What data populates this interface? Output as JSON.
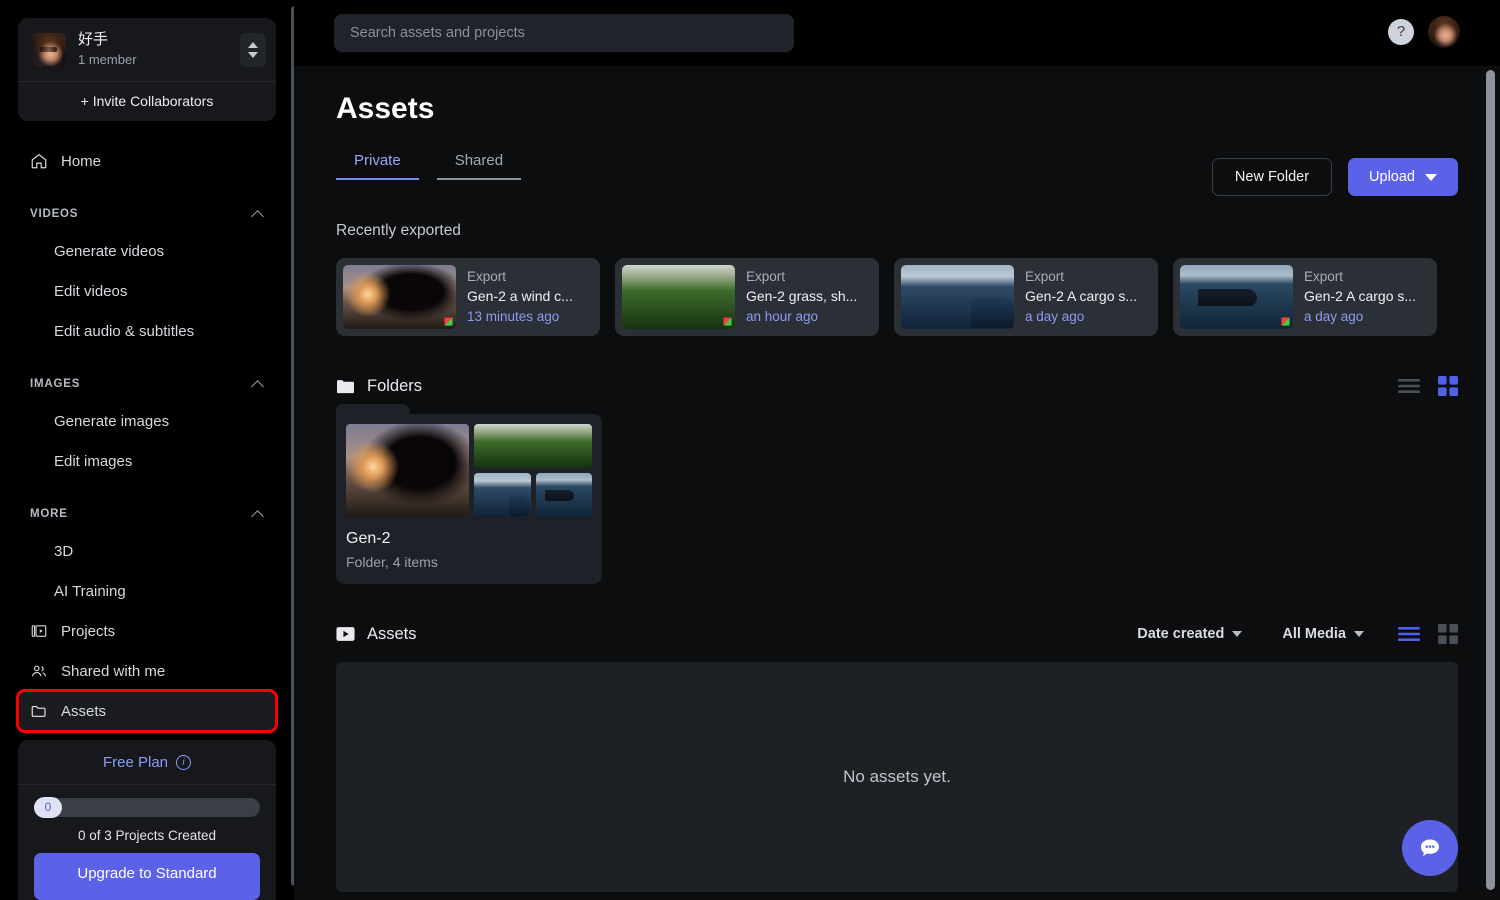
{
  "sidebar": {
    "team": {
      "name": "好手",
      "members": "1 member",
      "avatar": "user-avatar",
      "stepper_icon": "up-down-arrows-icon"
    },
    "invite_label": "+ Invite Collaborators",
    "home": {
      "label": "Home",
      "icon": "home-icon"
    },
    "sections": [
      {
        "label": "VIDEOS",
        "items": [
          {
            "label": "Generate videos"
          },
          {
            "label": "Edit videos"
          },
          {
            "label": "Edit audio & subtitles"
          }
        ]
      },
      {
        "label": "IMAGES",
        "items": [
          {
            "label": "Generate images"
          },
          {
            "label": "Edit images"
          }
        ]
      },
      {
        "label": "MORE",
        "items": [
          {
            "label": "3D"
          },
          {
            "label": "AI Training"
          }
        ]
      }
    ],
    "links": [
      {
        "label": "Projects",
        "icon": "projects-icon"
      },
      {
        "label": "Shared with me",
        "icon": "people-icon"
      },
      {
        "label": "Assets",
        "icon": "folder-icon"
      }
    ],
    "plan": {
      "title": "Free Plan",
      "info_icon": "info-icon",
      "progress_value": "0",
      "progress_label": "0 of 3 Projects Created",
      "upgrade_label": "Upgrade to Standard",
      "accent": "#5b62e8"
    }
  },
  "topbar": {
    "search_placeholder": "Search assets and projects",
    "search_value": "",
    "help_icon": "question-mark-icon",
    "avatar": "user-avatar"
  },
  "page": {
    "title": "Assets",
    "tabs": [
      {
        "label": "Private",
        "active": true
      },
      {
        "label": "Shared",
        "active": false
      }
    ],
    "actions": {
      "new_folder": "New Folder",
      "upload": "Upload",
      "upload_caret": "chevron-down-icon"
    }
  },
  "recently_exported": {
    "label": "Recently exported",
    "cards": [
      {
        "kind": "Export",
        "name": "Gen-2 a wind c...",
        "time": "13 minutes ago",
        "thumb": "sunset-tree-thumb"
      },
      {
        "kind": "Export",
        "name": "Gen-2 grass, sh...",
        "time": "an hour ago",
        "thumb": "grass-thumb"
      },
      {
        "kind": "Export",
        "name": "Gen-2 A cargo s...",
        "time": "a day ago",
        "thumb": "cargo-ship-sun-thumb"
      },
      {
        "kind": "Export",
        "name": "Gen-2 A cargo s...",
        "time": "a day ago",
        "thumb": "cargo-ship-thumb"
      }
    ]
  },
  "folders_section": {
    "label": "Folders",
    "icon": "folder-icon",
    "view_list_icon": "list-view-icon",
    "view_grid_icon": "grid-view-icon",
    "active_view": "grid",
    "folders": [
      {
        "name": "Gen-2",
        "subtitle": "Folder, 4 items"
      }
    ]
  },
  "assets_section": {
    "label": "Assets",
    "icon": "video-icon",
    "sort_by": "Date created",
    "filter": "All Media",
    "sort_caret": "chevron-down-icon",
    "filter_caret": "chevron-down-icon",
    "view_list_icon": "list-view-icon",
    "view_grid_icon": "grid-view-icon",
    "active_view": "list",
    "empty_text": "No assets yet."
  },
  "chat": {
    "icon": "chat-bubble-icon",
    "color": "#5b62e8"
  }
}
